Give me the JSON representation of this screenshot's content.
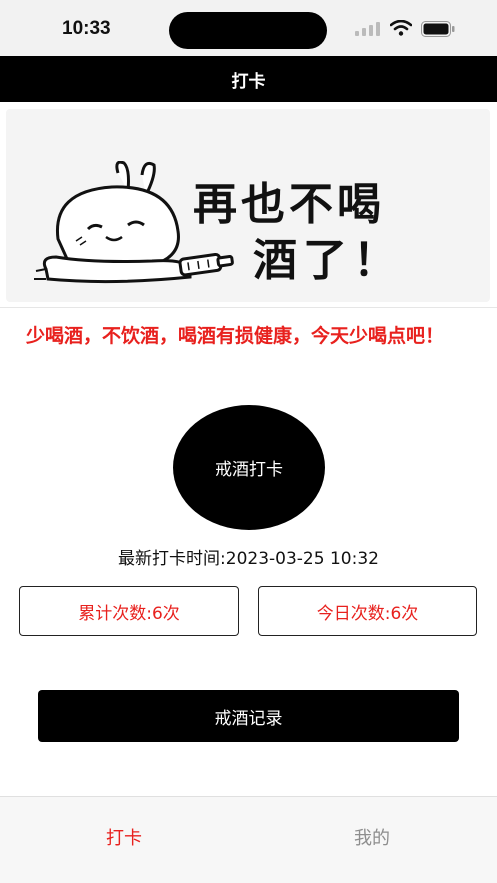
{
  "status_bar": {
    "time": "10:33"
  },
  "nav": {
    "title": "打卡"
  },
  "banner": {
    "line1": "再也不喝",
    "line2": "酒了！"
  },
  "slogan": "少喝酒，不饮酒，喝酒有损健康，今天少喝点吧！",
  "checkin_button": "戒酒打卡",
  "last_checkin": "最新打卡时间:2023-03-25 10:32",
  "counts": {
    "total": "累计次数:6次",
    "today": "今日次数:6次"
  },
  "records_button": "戒酒记录",
  "tabs": [
    {
      "label": "打卡",
      "active": true
    },
    {
      "label": "我的",
      "active": false
    }
  ],
  "colors": {
    "accent_red": "#e8211e",
    "nav_black": "#000000",
    "tab_inactive": "#8e8e8e"
  }
}
